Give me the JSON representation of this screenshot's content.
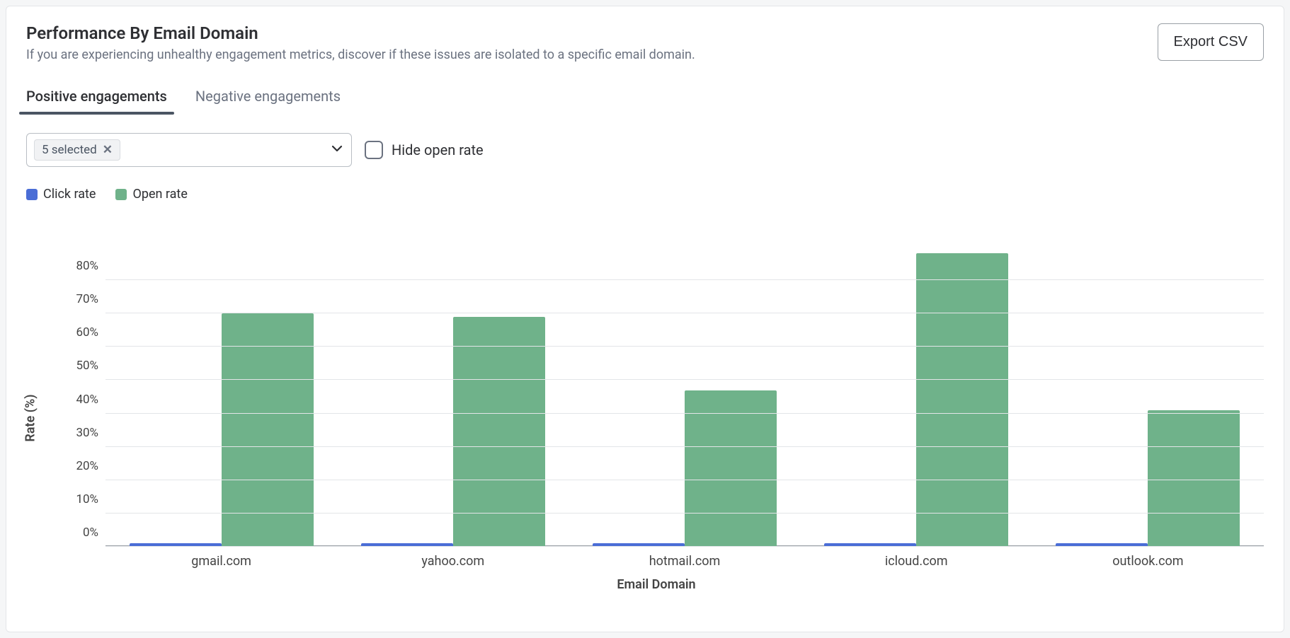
{
  "header": {
    "title": "Performance By Email Domain",
    "subtitle": "If you are experiencing unhealthy engagement metrics, discover if these issues are isolated to a specific email domain.",
    "export_label": "Export CSV"
  },
  "tabs": {
    "positive": "Positive engagements",
    "negative": "Negative engagements",
    "active": "positive"
  },
  "controls": {
    "selector_chip": "5 selected",
    "hide_open_label": "Hide open rate",
    "hide_open_checked": false
  },
  "legend": {
    "click": "Click rate",
    "open": "Open rate"
  },
  "colors": {
    "click": "#4a6dd6",
    "open": "#6fb28a"
  },
  "chart_data": {
    "type": "bar",
    "xlabel": "Email Domain",
    "ylabel": "Rate (%)",
    "ylim": [
      0,
      90
    ],
    "yticks": [
      0,
      10,
      20,
      30,
      40,
      50,
      60,
      70,
      80
    ],
    "categories": [
      "gmail.com",
      "yahoo.com",
      "hotmail.com",
      "icloud.com",
      "outlook.com"
    ],
    "series": [
      {
        "name": "Click rate",
        "color": "#4a6dd6",
        "values": [
          1,
          1,
          1,
          1,
          1
        ]
      },
      {
        "name": "Open rate",
        "color": "#6fb28a",
        "values": [
          70,
          69,
          47,
          88,
          41
        ]
      }
    ]
  }
}
